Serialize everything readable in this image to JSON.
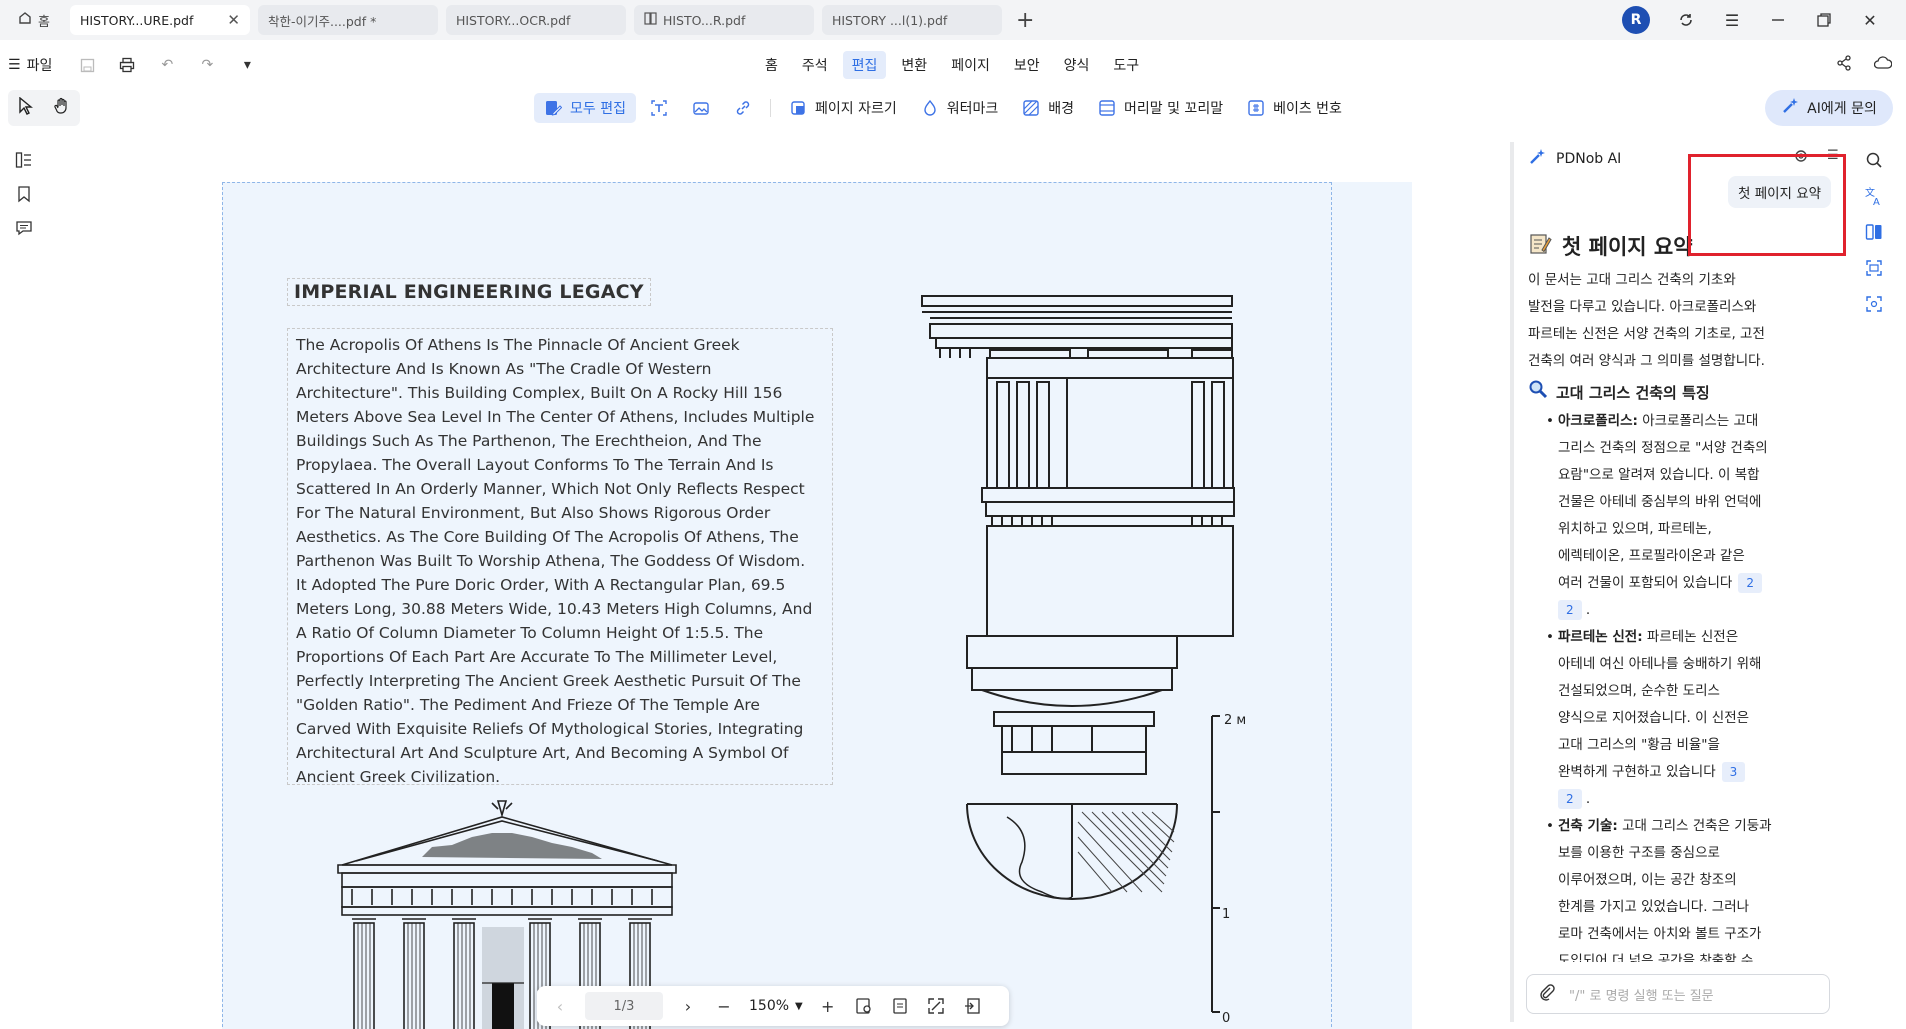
{
  "tabs": {
    "home_label": "홈",
    "items": [
      {
        "label": "HISTORY...URE.pdf",
        "active": true,
        "closable": true
      },
      {
        "label": "착한-이기주....pdf *",
        "active": false
      },
      {
        "label": "HISTORY...OCR.pdf",
        "active": false
      },
      {
        "label": "HISTO...R.pdf",
        "active": false
      },
      {
        "label": "HISTORY ...l(1).pdf",
        "active": false
      }
    ],
    "avatar_letter": "R"
  },
  "menubar": {
    "file_label": "파일",
    "menus": [
      "홈",
      "주석",
      "편집",
      "변환",
      "페이지",
      "보안",
      "양식",
      "도구"
    ],
    "active_menu": "편집"
  },
  "toolbar": {
    "edit_all": "모두 편집",
    "crop_page": "페이지 자르기",
    "watermark": "워터마크",
    "background": "배경",
    "header_footer": "머리말 및 꼬리말",
    "bates": "베이츠 번호",
    "ask_ai": "AI에게 문의"
  },
  "document": {
    "heading": "IMPERIAL ENGINEERING LEGACY",
    "paragraph_lines": [
      "The Acropolis Of Athens Is The Pinnacle Of Ancient Greek",
      "Architecture And Is Known As \"The Cradle Of Western",
      "Architecture\". This Building Complex, Built On A Rocky Hill 156",
      "Meters Above Sea Level In The Center Of Athens, Includes Multiple",
      "Buildings Such As The Parthenon, The Erechtheion, And The",
      "Propylaea. The Overall Layout Conforms To The Terrain And Is",
      "Scattered In An Orderly Manner, Which Not Only Reflects Respect",
      "For The Natural Environment, But Also Shows Rigorous Order",
      "Aesthetics. As The Core Building Of The Acropolis Of Athens, The",
      "Parthenon Was Built To Worship Athena, The Goddess Of Wisdom.",
      "It Adopted The Pure Doric Order, With A Rectangular Plan, 69.5",
      "Meters Long, 30.88 Meters Wide, 10.43 Meters High Columns, And",
      "A Ratio Of Column Diameter To Column Height Of 1:5.5. The",
      "Proportions Of Each Part Are Accurate To The Millimeter Level,",
      "Perfectly Interpreting The Ancient Greek Aesthetic Pursuit Of The",
      "\"Golden Ratio\". The Pediment And Frieze Of The Temple Are",
      "Carved With Exquisite Reliefs Of Mythological Stories, Integrating",
      "Architectural Art And Sculpture Art, And Becoming A Symbol Of",
      "Ancient Greek Civilization."
    ],
    "scale_labels": {
      "top": "2 м",
      "mid": "1",
      "bottom": "0"
    }
  },
  "bottom_nav": {
    "page_indicator": "1/3",
    "zoom": "150%"
  },
  "ai_panel": {
    "title": "PDNob AI",
    "user_message": "첫 페이지 요약",
    "summary_title": "첫 페이지 요약",
    "intro_lines": [
      "이 문서는 고대 그리스 건축의 기초와",
      "발전을 다루고 있습니다. 아크로폴리스와",
      "파르테논 신전은 서양 건축의 기초로, 고전",
      "건축의 여러 양식과 그 의미를 설명합니다."
    ],
    "section_title": "고대 그리스 건축의 특징",
    "bullets": [
      {
        "term": "아크로폴리스:",
        "lines": [
          " 아크로폴리스는 고대",
          "그리스 건축의 정점으로 \"서양 건축의",
          "요람\"으로 알려져 있습니다. 이 복합",
          "건물은 아테네 중심부의 바위 언덕에",
          "위치하고 있으며, 파르테논,",
          "에렉테이온, 프로필라이온과 같은",
          "여러 건물이 포함되어 있습니다"
        ],
        "cite_a": "2",
        "cite_b": "2"
      },
      {
        "term": "파르테논 신전:",
        "lines": [
          " 파르테논 신전은",
          "아테네 여신 아테나를 숭배하기 위해",
          "건설되었으며, 순수한 도리스",
          "양식으로 지어졌습니다. 이 신전은",
          "고대 그리스의 \"황금 비율\"을",
          "완벽하게 구현하고 있습니다"
        ],
        "cite_a": "3",
        "cite_b": "2"
      },
      {
        "term": "건축 기술:",
        "lines": [
          " 고대 그리스 건축은 기둥과",
          "보를 이용한 구조를 중심으로",
          "이루어졌으며, 이는 공간 창조의",
          "한계를 가지고 있었습니다. 그러나",
          "로마 건축에서는 아치와 볼트 구조가",
          "도입되어 더 넓은 공간을 창출할 수"
        ]
      }
    ],
    "input_placeholder": "\"/\" 로 명령 실행 또는 질문"
  },
  "colors": {
    "accent": "#2f6fe4",
    "highlight": "#e0222d",
    "page_bg": "#eef5fd"
  }
}
